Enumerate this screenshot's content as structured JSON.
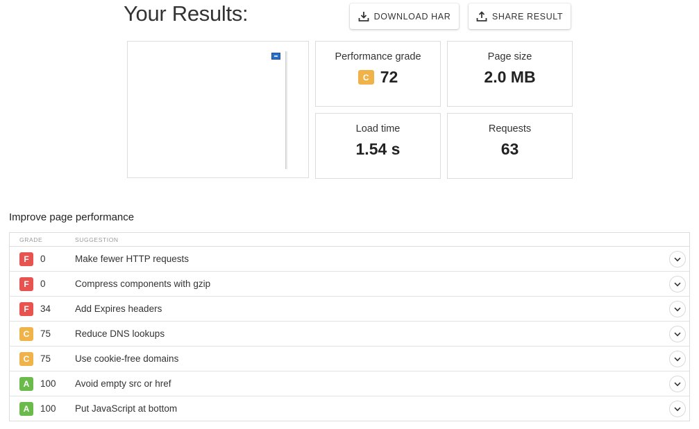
{
  "header": {
    "title": "Your Results:",
    "download_label": "DOWNLOAD HAR",
    "share_label": "SHARE RESULT"
  },
  "metrics": {
    "performance": {
      "label": "Performance grade",
      "grade": "C",
      "value": "72"
    },
    "page_size": {
      "label": "Page size",
      "value": "2.0 MB"
    },
    "load_time": {
      "label": "Load time",
      "value": "1.54 s"
    },
    "requests": {
      "label": "Requests",
      "value": "63"
    }
  },
  "colors": {
    "F": "#e8534f",
    "C": "#f0b34a",
    "A": "#6bbb4c"
  },
  "improve": {
    "title": "Improve page performance",
    "col_grade": "GRADE",
    "col_suggestion": "SUGGESTION",
    "rows": [
      {
        "grade": "F",
        "score": "0",
        "suggestion": "Make fewer HTTP requests"
      },
      {
        "grade": "F",
        "score": "0",
        "suggestion": "Compress components with gzip"
      },
      {
        "grade": "F",
        "score": "34",
        "suggestion": "Add Expires headers"
      },
      {
        "grade": "C",
        "score": "75",
        "suggestion": "Reduce DNS lookups"
      },
      {
        "grade": "C",
        "score": "75",
        "suggestion": "Use cookie-free domains"
      },
      {
        "grade": "A",
        "score": "100",
        "suggestion": "Avoid empty src or href"
      },
      {
        "grade": "A",
        "score": "100",
        "suggestion": "Put JavaScript at bottom"
      }
    ]
  }
}
